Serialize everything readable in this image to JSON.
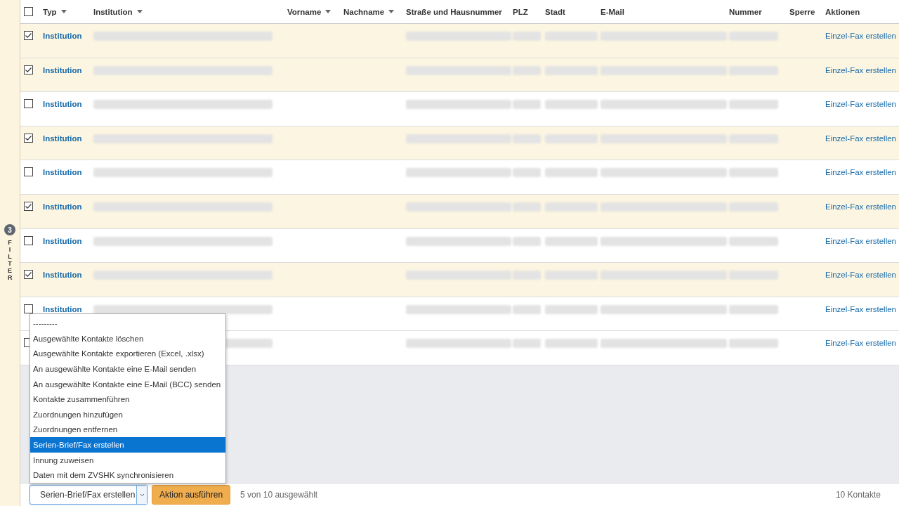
{
  "sidebar": {
    "badge": "3",
    "label": "FILTER"
  },
  "table": {
    "select_all_checked": false,
    "columns": [
      {
        "label": "Typ",
        "sortable": true,
        "blurred": false
      },
      {
        "label": "Institution",
        "sortable": true,
        "blurred": true
      },
      {
        "label": "Vorname",
        "sortable": true,
        "blurred": false
      },
      {
        "label": "Nachname",
        "sortable": true,
        "blurred": false
      },
      {
        "label": "Straße und Hausnummer",
        "sortable": false,
        "blurred": true
      },
      {
        "label": "PLZ",
        "sortable": false,
        "blurred": true
      },
      {
        "label": "Stadt",
        "sortable": false,
        "blurred": true
      },
      {
        "label": "E-Mail",
        "sortable": false,
        "blurred": true
      },
      {
        "label": "Nummer",
        "sortable": false,
        "blurred": true
      },
      {
        "label": "Sperre",
        "sortable": false,
        "blurred": false
      },
      {
        "label": "Aktionen",
        "sortable": false,
        "blurred": false
      }
    ],
    "rows": [
      {
        "checked": true,
        "type": "Institution",
        "action": "Einzel-Fax erstellen"
      },
      {
        "checked": true,
        "type": "Institution",
        "action": "Einzel-Fax erstellen"
      },
      {
        "checked": false,
        "type": "Institution",
        "action": "Einzel-Fax erstellen"
      },
      {
        "checked": true,
        "type": "Institution",
        "action": "Einzel-Fax erstellen"
      },
      {
        "checked": false,
        "type": "Institution",
        "action": "Einzel-Fax erstellen"
      },
      {
        "checked": true,
        "type": "Institution",
        "action": "Einzel-Fax erstellen"
      },
      {
        "checked": false,
        "type": "Institution",
        "action": "Einzel-Fax erstellen"
      },
      {
        "checked": true,
        "type": "Institution",
        "action": "Einzel-Fax erstellen"
      },
      {
        "checked": false,
        "type": "Institution",
        "action": "Einzel-Fax erstellen"
      },
      {
        "checked": false,
        "action": "Einzel-Fax erstellen"
      }
    ]
  },
  "action_menu": {
    "options": [
      {
        "label": "---------",
        "selected": false
      },
      {
        "label": "Ausgewählte Kontakte löschen",
        "selected": false
      },
      {
        "label": "Ausgewählte Kontakte exportieren (Excel, .xlsx)",
        "selected": false
      },
      {
        "label": "An ausgewählte Kontakte eine E-Mail senden",
        "selected": false
      },
      {
        "label": "An ausgewählte Kontakte eine E-Mail (BCC) senden",
        "selected": false
      },
      {
        "label": "Kontakte zusammenführen",
        "selected": false
      },
      {
        "label": "Zuordnungen hinzufügen",
        "selected": false
      },
      {
        "label": "Zuordnungen entfernen",
        "selected": false
      },
      {
        "label": "Serien-Brief/Fax erstellen",
        "selected": true
      },
      {
        "label": "Innung zuweisen",
        "selected": false
      },
      {
        "label": "Daten mit dem ZVSHK synchronisieren",
        "selected": false
      }
    ]
  },
  "action_bar": {
    "select_value": "Serien-Brief/Fax erstellen",
    "button": "Aktion ausführen",
    "selection_info": "5 von 10 ausgewählt",
    "total": "10 Kontakte"
  }
}
